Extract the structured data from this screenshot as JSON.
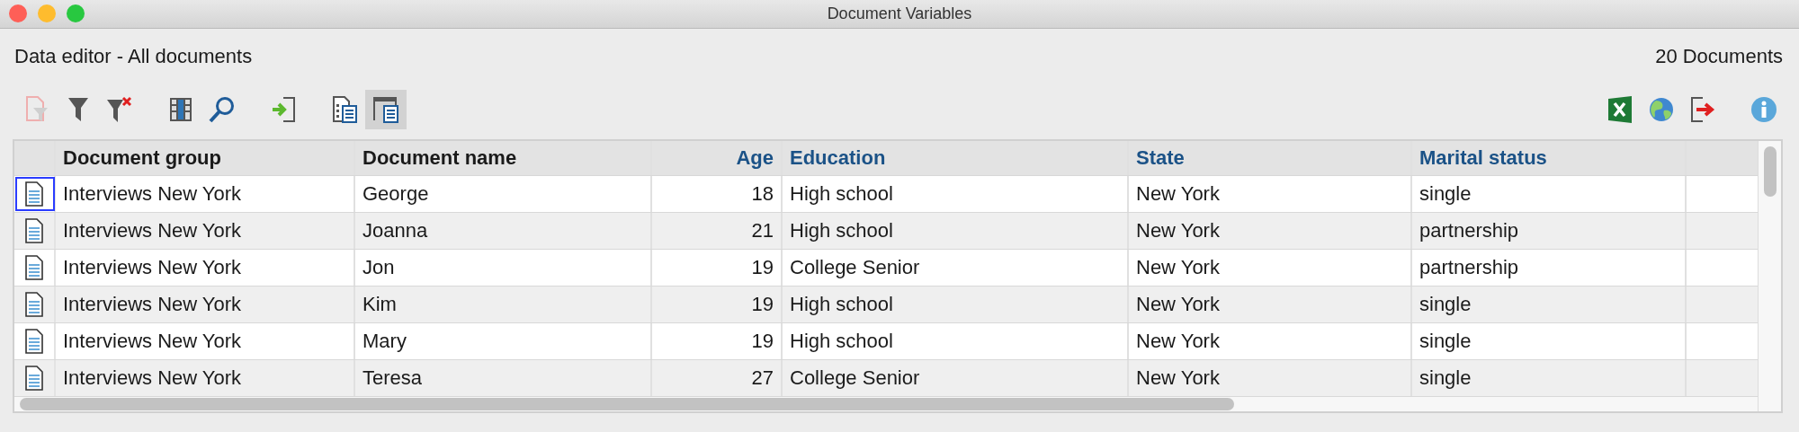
{
  "window": {
    "title": "Document Variables"
  },
  "header": {
    "title": "Data editor - All documents",
    "count": "20 Documents"
  },
  "toolbar": {
    "left": [
      {
        "kind": "doc-filter",
        "disabled": true,
        "selected": false
      },
      {
        "kind": "filter",
        "disabled": false,
        "selected": false
      },
      {
        "kind": "filter-clear",
        "disabled": false,
        "selected": false
      },
      {
        "kind": "gap"
      },
      {
        "kind": "columns",
        "disabled": false,
        "selected": false
      },
      {
        "kind": "search",
        "disabled": false,
        "selected": false
      },
      {
        "kind": "gap"
      },
      {
        "kind": "import",
        "disabled": false,
        "selected": false
      },
      {
        "kind": "gap"
      },
      {
        "kind": "list-view",
        "disabled": false,
        "selected": false
      },
      {
        "kind": "window-view",
        "disabled": false,
        "selected": true
      }
    ],
    "right": [
      {
        "kind": "spreadsheet",
        "disabled": false,
        "selected": false
      },
      {
        "kind": "globe",
        "disabled": false,
        "selected": false
      },
      {
        "kind": "export",
        "disabled": false,
        "selected": false
      },
      {
        "kind": "gap"
      },
      {
        "kind": "info",
        "disabled": false,
        "selected": false
      }
    ]
  },
  "table": {
    "columns": [
      {
        "label": "Document group",
        "kind": "system"
      },
      {
        "label": "Document name",
        "kind": "system"
      },
      {
        "label": "Age",
        "kind": "number"
      },
      {
        "label": "Education",
        "kind": "text"
      },
      {
        "label": "State",
        "kind": "text"
      },
      {
        "label": "Marital status",
        "kind": "text"
      }
    ],
    "rows": [
      {
        "focused": true,
        "cells": [
          "Interviews New York",
          "George",
          "18",
          "High school",
          "New York",
          "single"
        ]
      },
      {
        "focused": false,
        "cells": [
          "Interviews New York",
          "Joanna",
          "21",
          "High school",
          "New York",
          "partnership"
        ]
      },
      {
        "focused": false,
        "cells": [
          "Interviews New York",
          "Jon",
          "19",
          "College Senior",
          "New York",
          "partnership"
        ]
      },
      {
        "focused": false,
        "cells": [
          "Interviews New York",
          "Kim",
          "19",
          "High school",
          "New York",
          "single"
        ]
      },
      {
        "focused": false,
        "cells": [
          "Interviews New York",
          "Mary",
          "19",
          "High school",
          "New York",
          "single"
        ]
      },
      {
        "focused": false,
        "cells": [
          "Interviews New York",
          "Teresa",
          "27",
          "College Senior",
          "New York",
          "single"
        ]
      }
    ]
  }
}
